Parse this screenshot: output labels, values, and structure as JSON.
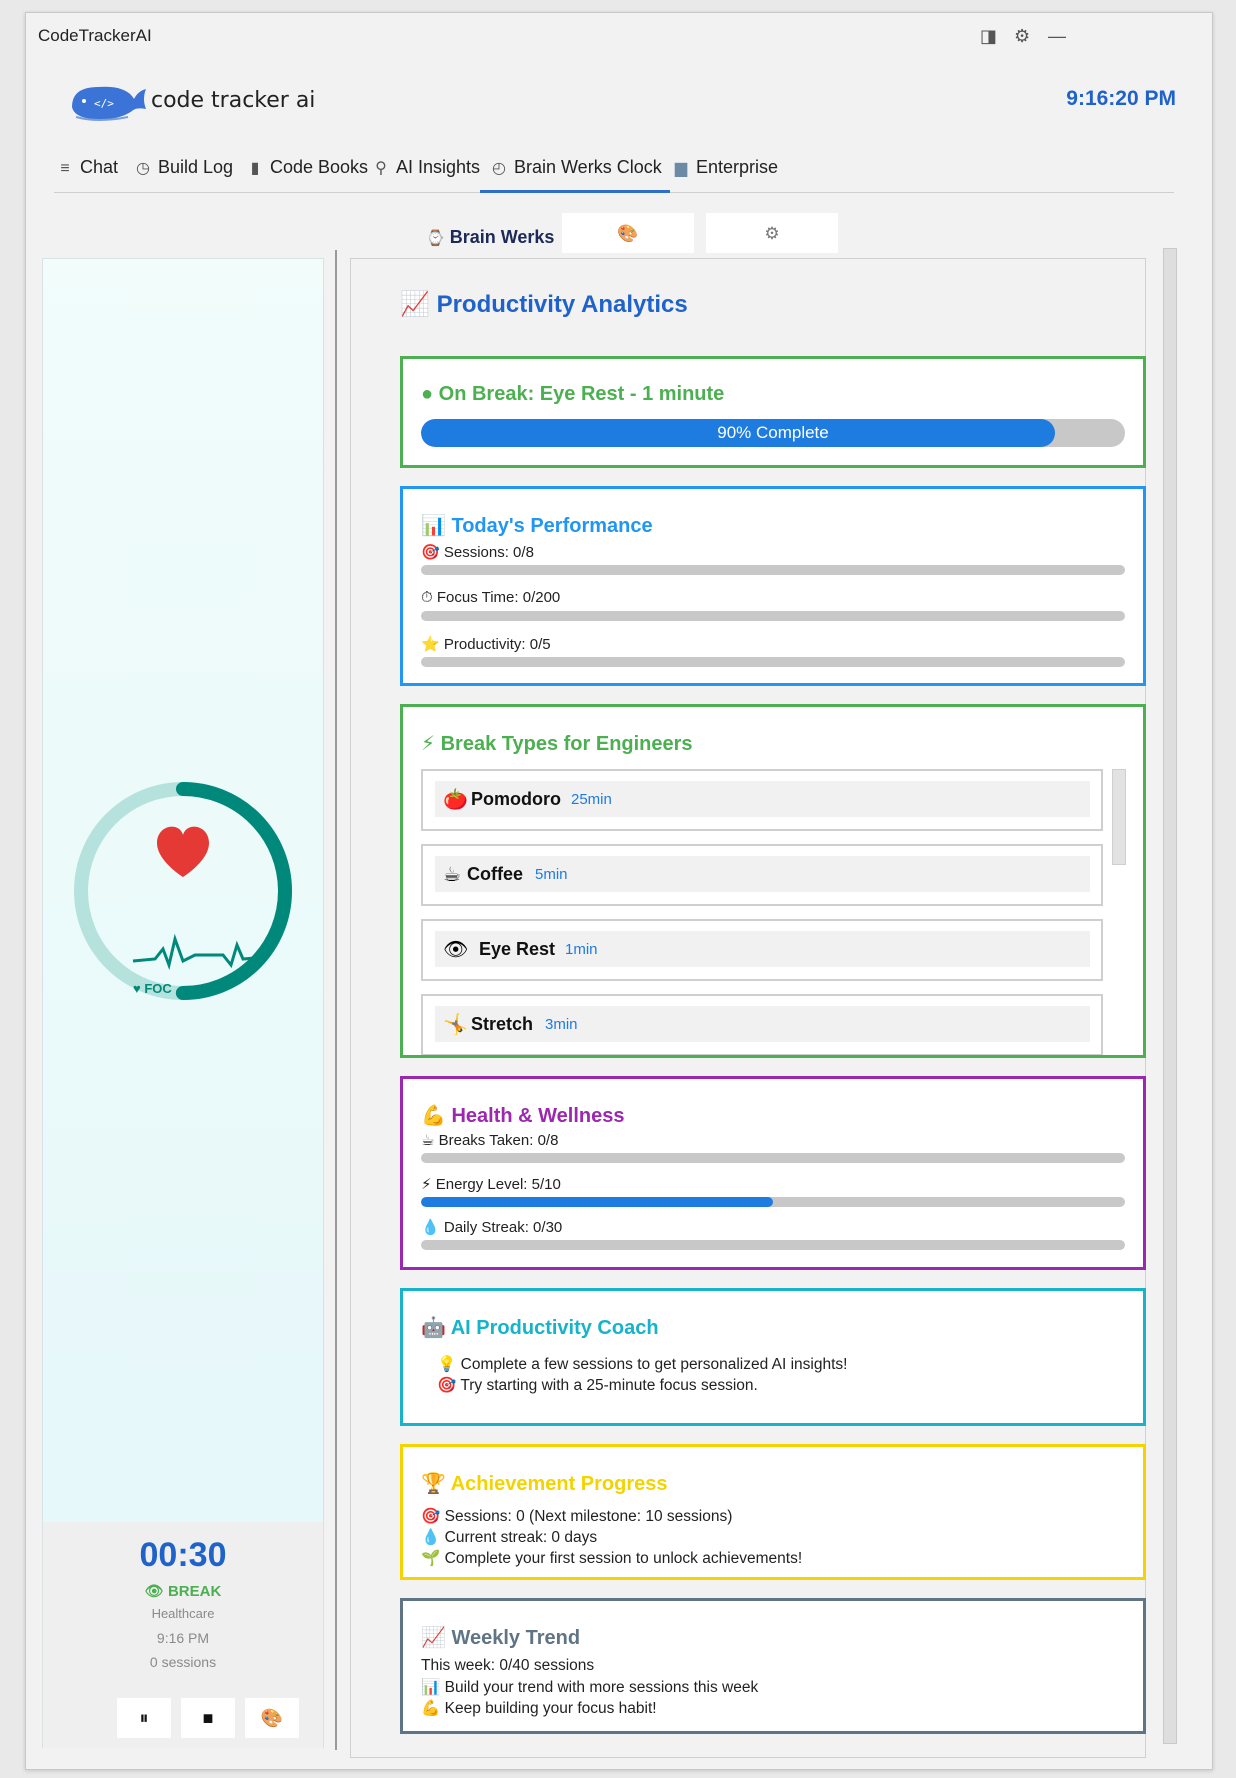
{
  "window": {
    "title": "CodeTrackerAI"
  },
  "header": {
    "logo_text": "code tracker ai",
    "clock": "9:16:20 PM"
  },
  "tabs": [
    {
      "label": "Chat",
      "icon": "chat-lines-icon"
    },
    {
      "label": "Build Log",
      "icon": "clock-icon"
    },
    {
      "label": "Code Books",
      "icon": "book-icon"
    },
    {
      "label": "AI Insights",
      "icon": "search-icon"
    },
    {
      "label": "Brain Werks Clock",
      "icon": "clock-play-icon"
    },
    {
      "label": "Enterprise",
      "icon": "folder-icon"
    }
  ],
  "subtabs": {
    "active_label": "Brain Werks",
    "icons": [
      "palette-icon",
      "gear-icon"
    ]
  },
  "timer": {
    "time": "00:30",
    "mode": "BREAK",
    "category": "Healthcare",
    "clock": "9:16 PM",
    "sessions": "0 sessions",
    "ring_label": "♥ FOC",
    "ring_progress": 0.5
  },
  "analytics": {
    "title": "Productivity Analytics",
    "on_break": {
      "title": "On Break: Eye Rest - 1 minute",
      "progress_label": "90% Complete",
      "progress": 0.9
    },
    "today": {
      "title": "Today's Performance",
      "rows": [
        {
          "icon": "🎯",
          "label": "Sessions: 0/8",
          "value": 0
        },
        {
          "icon": "⏱",
          "label": "Focus Time: 0/200",
          "value": 0
        },
        {
          "icon": "⭐",
          "label": "Productivity: 0/5",
          "value": 0
        }
      ]
    },
    "break_types": {
      "title": "Break Types for Engineers",
      "items": [
        {
          "icon": "🍅",
          "name": "Pomodoro",
          "duration": "25min"
        },
        {
          "icon": "☕",
          "name": "Coffee",
          "duration": "5min"
        },
        {
          "icon": "👁",
          "name": "Eye Rest",
          "duration": "1min"
        },
        {
          "icon": "🤸",
          "name": "Stretch",
          "duration": "3min"
        }
      ]
    },
    "health": {
      "title": "Health & Wellness",
      "rows": [
        {
          "icon": "☕",
          "label": "Breaks Taken: 0/8",
          "value": 0
        },
        {
          "icon": "⚡",
          "label": "Energy Level: 5/10",
          "value": 0.5
        },
        {
          "icon": "💧",
          "label": "Daily Streak: 0/30",
          "value": 0
        }
      ]
    },
    "coach": {
      "title": "AI Productivity Coach",
      "lines": [
        "Complete a few sessions to get personalized AI insights!",
        "Try starting with a 25-minute focus session."
      ]
    },
    "achievement": {
      "title": "Achievement Progress",
      "lines": [
        "Sessions: 0 (Next milestone: 10 sessions)",
        "Current streak: 0 days",
        "Complete your first session to unlock achievements!"
      ]
    },
    "weekly": {
      "title": "Weekly Trend",
      "lines": [
        "This week: 0/40 sessions",
        "Build your trend with more sessions this week",
        "Keep building your focus habit!"
      ]
    }
  },
  "colors": {
    "green": "#4caf50",
    "blue": "#2196f3",
    "purple": "#9c27b0",
    "cyan": "#17b3c9",
    "yellow": "#f3d400",
    "slate": "#5f7586",
    "teal": "#00897b"
  }
}
